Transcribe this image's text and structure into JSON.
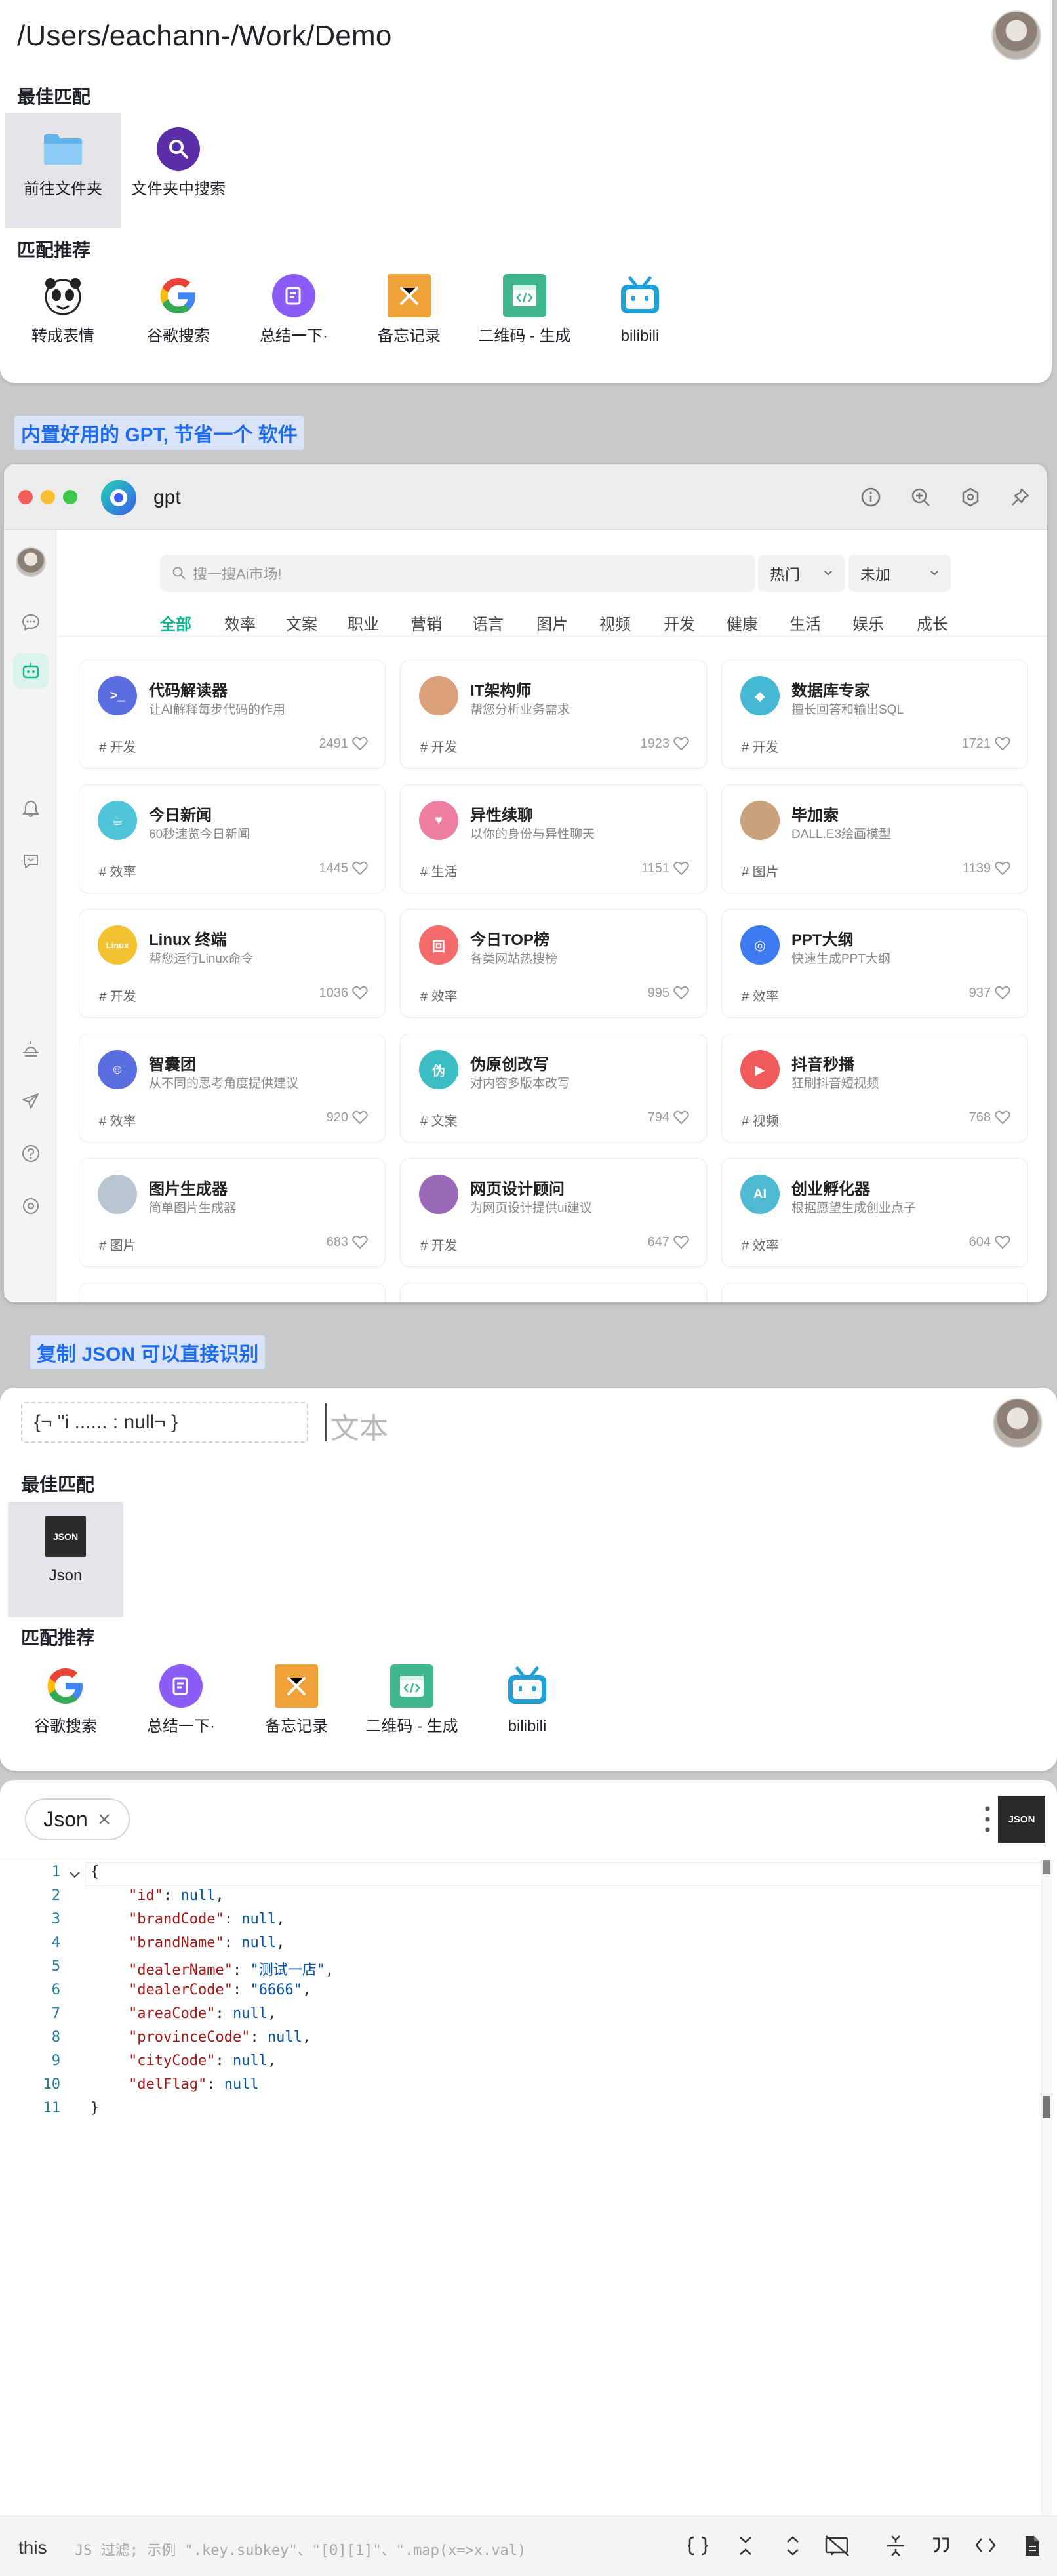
{
  "panel1": {
    "query": "/Users/eachann-/Work/Demo",
    "best_match_title": "最佳匹配",
    "best_matches": [
      {
        "label": "前往文件夹",
        "icon": "folder-icon"
      },
      {
        "label": "文件夹中搜索",
        "icon": "search-icon"
      }
    ],
    "recommend_title": "匹配推荐",
    "recommends": [
      {
        "label": "转成表情",
        "icon": "panda-meme-icon"
      },
      {
        "label": "谷歌搜索",
        "icon": "google-icon"
      },
      {
        "label": "总结一下·",
        "icon": "summary-icon"
      },
      {
        "label": "备忘记录",
        "icon": "memo-icon"
      },
      {
        "label": "二维码 - 生成",
        "icon": "qrcode-icon"
      },
      {
        "label": "bilibili",
        "icon": "bilibili-icon"
      }
    ]
  },
  "captions": {
    "gpt": "内置好用的 GPT, 节省一个 软件",
    "json": "复制 JSON 可以直接识别"
  },
  "gpt": {
    "title": "gpt",
    "search_placeholder": "搜一搜Ai市场!",
    "dropdown_sort": "热门",
    "dropdown_filter": "未加",
    "tabs": [
      "全部",
      "效率",
      "文案",
      "职业",
      "营销",
      "语言",
      "图片",
      "视频",
      "开发",
      "健康",
      "生活",
      "娱乐",
      "成长"
    ],
    "cards": [
      {
        "name": "代码解读器",
        "desc": "让AI解释每步代码的作用",
        "tag": "# 开发",
        "count": "2491",
        "icon": "terminal-icon",
        "color": "#5b6ee1"
      },
      {
        "name": "IT架构师",
        "desc": "帮您分析业务需求",
        "tag": "# 开发",
        "count": "1923",
        "icon": "architect-avatar",
        "color": "#d9a07a"
      },
      {
        "name": "数据库专家",
        "desc": "擅长回答和输出SQL",
        "tag": "# 开发",
        "count": "1721",
        "icon": "database-icon",
        "color": "#47b8d3"
      },
      {
        "name": "今日新闻",
        "desc": "60秒速览今日新闻",
        "tag": "# 效率",
        "count": "1445",
        "icon": "coffee-icon",
        "color": "#4fc3d8"
      },
      {
        "name": "异性续聊",
        "desc": "以你的身份与异性聊天",
        "tag": "# 生活",
        "count": "1151",
        "icon": "chat-heart-icon",
        "color": "#ee7ea0"
      },
      {
        "name": "毕加索",
        "desc": "DALL.E3绘画模型",
        "tag": "# 图片",
        "count": "1139",
        "icon": "picasso-avatar",
        "color": "#c9a27b"
      },
      {
        "name": "Linux 终端",
        "desc": "帮您运行Linux命令",
        "tag": "# 开发",
        "count": "1036",
        "icon": "linux-icon",
        "color": "#f2c230"
      },
      {
        "name": "今日TOP榜",
        "desc": "各类网站热搜榜",
        "tag": "# 效率",
        "count": "995",
        "icon": "top-list-icon",
        "color": "#f36b6b"
      },
      {
        "name": "PPT大纲",
        "desc": "快速生成PPT大纲",
        "tag": "# 效率",
        "count": "937",
        "icon": "presentation-icon",
        "color": "#3f7bf0"
      },
      {
        "name": "智囊团",
        "desc": "从不同的思考角度提供建议",
        "tag": "# 效率",
        "count": "920",
        "icon": "brain-icon",
        "color": "#5b6ee1"
      },
      {
        "name": "伪原创改写",
        "desc": "对内容多版本改写",
        "tag": "# 文案",
        "count": "794",
        "icon": "rewrite-icon",
        "color": "#3cbcc4"
      },
      {
        "name": "抖音秒播",
        "desc": "狂刷抖音短视频",
        "tag": "# 视频",
        "count": "768",
        "icon": "play-icon",
        "color": "#f05a5a"
      },
      {
        "name": "图片生成器",
        "desc": "简单图片生成器",
        "tag": "# 图片",
        "count": "683",
        "icon": "painter-avatar",
        "color": "#b8c4cf"
      },
      {
        "name": "网页设计顾问",
        "desc": "为网页设计提供ui建议",
        "tag": "# 开发",
        "count": "647",
        "icon": "designer-avatar",
        "color": "#9a6ab8"
      },
      {
        "name": "创业孵化器",
        "desc": "根据愿望生成创业点子",
        "tag": "# 效率",
        "count": "604",
        "icon": "ai-icon",
        "color": "#4fb9d4"
      }
    ]
  },
  "panel3": {
    "clip_text": "{¬ \"i ...... : null¬ }",
    "placeholder": "文本",
    "best_match_title": "最佳匹配",
    "best_matches": [
      {
        "label": "Json",
        "icon": "json-icon"
      }
    ],
    "recommend_title": "匹配推荐",
    "recommends": [
      {
        "label": "谷歌搜索",
        "icon": "google-icon"
      },
      {
        "label": "总结一下·",
        "icon": "summary-icon"
      },
      {
        "label": "备忘记录",
        "icon": "memo-icon"
      },
      {
        "label": "二维码 - 生成",
        "icon": "qrcode-icon"
      },
      {
        "label": "bilibili",
        "icon": "bilibili-icon"
      }
    ]
  },
  "panel4": {
    "tag_label": "Json",
    "badge": "JSON",
    "lines": [
      {
        "n": "1",
        "text": "{"
      },
      {
        "n": "2",
        "key": "\"id\"",
        "val": "null",
        "comma": ","
      },
      {
        "n": "3",
        "key": "\"brandCode\"",
        "val": "null",
        "comma": ","
      },
      {
        "n": "4",
        "key": "\"brandName\"",
        "val": "null",
        "comma": ","
      },
      {
        "n": "5",
        "key": "\"dealerName\"",
        "val": "\"测试一店\"",
        "comma": ","
      },
      {
        "n": "6",
        "key": "\"dealerCode\"",
        "val": "\"6666\"",
        "comma": ","
      },
      {
        "n": "7",
        "key": "\"areaCode\"",
        "val": "null",
        "comma": ","
      },
      {
        "n": "8",
        "key": "\"provinceCode\"",
        "val": "null",
        "comma": ","
      },
      {
        "n": "9",
        "key": "\"cityCode\"",
        "val": "null",
        "comma": ","
      },
      {
        "n": "10",
        "key": "\"delFlag\"",
        "val": "null",
        "comma": ""
      },
      {
        "n": "11",
        "text": "}"
      }
    ],
    "filter_prefix": "this",
    "filter_placeholder": "JS 过滤; 示例 \".key.subkey\"、\"[0][1]\"、\".map(x=>x.val)"
  }
}
